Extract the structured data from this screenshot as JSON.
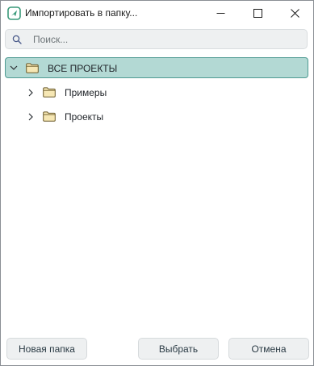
{
  "window": {
    "title": "Импортировать в папку...",
    "app_icon": "app-logo-icon",
    "controls": [
      "minimize-icon",
      "maximize-icon",
      "close-icon"
    ]
  },
  "search": {
    "placeholder": "Поиск...",
    "value": "",
    "icon": "search-icon"
  },
  "tree": {
    "root": {
      "label": "ВСЕ ПРОЕКТЫ",
      "expanded": true,
      "selected": true,
      "icon": "folder-icon"
    },
    "children": [
      {
        "label": "Примеры",
        "expanded": false,
        "icon": "folder-icon"
      },
      {
        "label": "Проекты",
        "expanded": false,
        "icon": "folder-icon"
      }
    ]
  },
  "buttons": {
    "new_folder": "Новая папка",
    "select": "Выбрать",
    "cancel": "Отмена"
  },
  "colors": {
    "accent": "#3a9a7a",
    "selection_bg": "#b3d9d4",
    "selection_border": "#4f9b93",
    "folder_fill": "#f6e7b4",
    "folder_stroke": "#6b5a2a",
    "button_bg": "#eef0f1"
  }
}
